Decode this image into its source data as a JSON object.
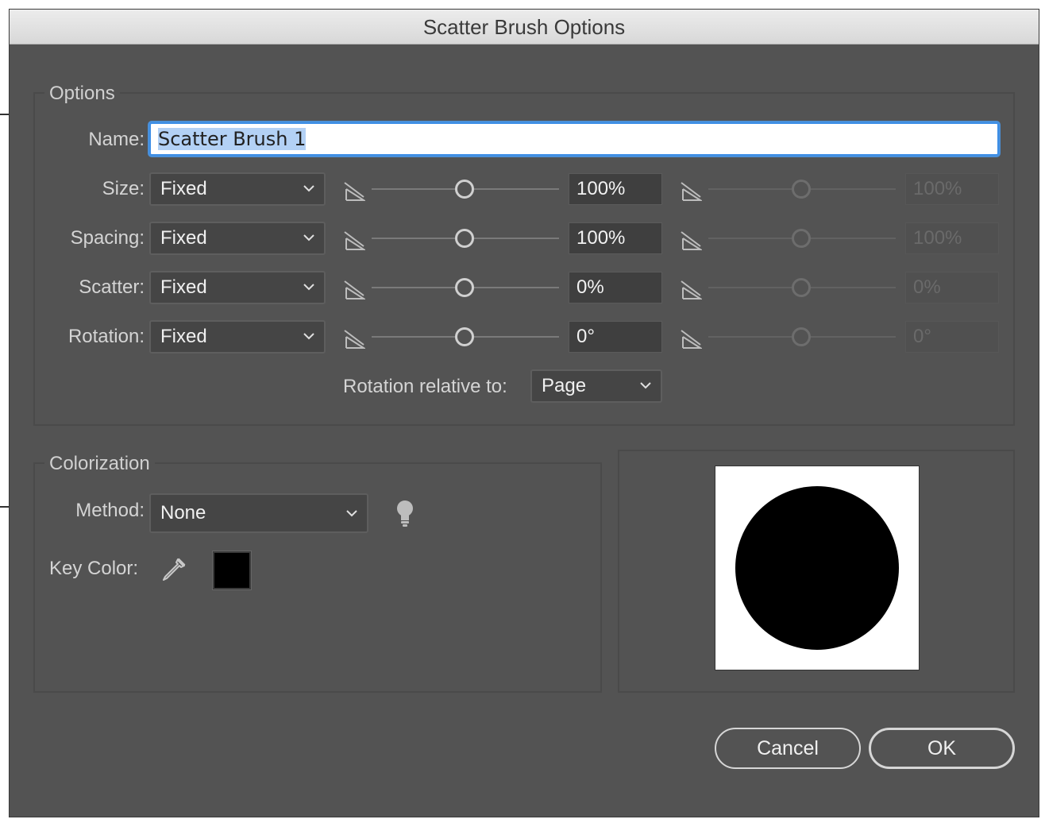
{
  "window": {
    "title": "Scatter Brush Options"
  },
  "options": {
    "group_title": "Options",
    "name_label": "Name:",
    "name_value": "Scatter Brush 1",
    "rows": [
      {
        "label": "Size:",
        "mode": "Fixed",
        "value": "100%",
        "value2": "100%",
        "slider": 0.5
      },
      {
        "label": "Spacing:",
        "mode": "Fixed",
        "value": "100%",
        "value2": "100%",
        "slider": 0.5
      },
      {
        "label": "Scatter:",
        "mode": "Fixed",
        "value": "0%",
        "value2": "0%",
        "slider": 0.5
      },
      {
        "label": "Rotation:",
        "mode": "Fixed",
        "value": "0°",
        "value2": "0°",
        "slider": 0.5
      }
    ],
    "rotation_relative_label": "Rotation relative to:",
    "rotation_relative_value": "Page"
  },
  "colorization": {
    "group_title": "Colorization",
    "method_label": "Method:",
    "method_value": "None",
    "key_color_label": "Key Color:",
    "key_color": "#000000",
    "tips_icon": "lightbulb-icon",
    "eyedropper_icon": "eyedropper-icon"
  },
  "preview": {
    "shape": "circle",
    "fill": "#000000"
  },
  "buttons": {
    "cancel": "Cancel",
    "ok": "OK"
  }
}
